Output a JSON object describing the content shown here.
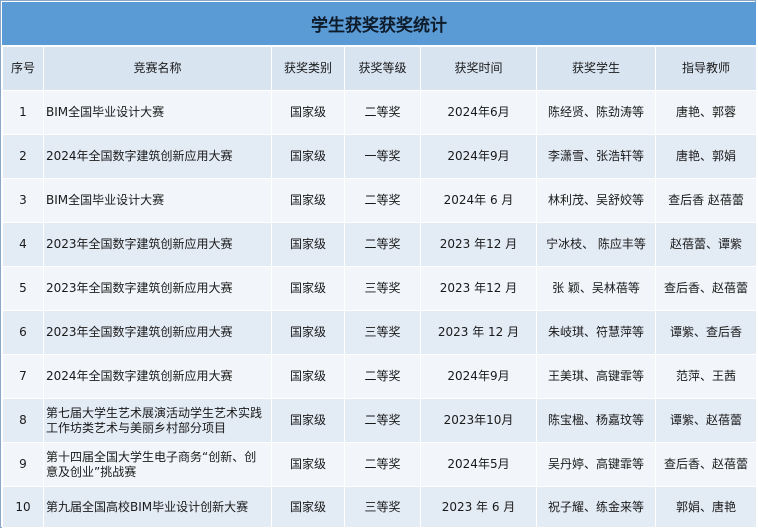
{
  "title": "学生获奖获奖统计",
  "columns": [
    "序号",
    "竞赛名称",
    "获奖类别",
    "获奖等级",
    "获奖时间",
    "获奖学生",
    "指导教师"
  ],
  "rows": [
    [
      "1",
      "BIM全国毕业设计大赛",
      "国家级",
      "二等奖",
      "2024年6月",
      "陈经贤、陈劲涛等",
      "唐艳、郭蓉"
    ],
    [
      "2",
      "2024年全国数字建筑创新应用大赛",
      "国家级",
      "一等奖",
      "2024年9月",
      "李潇雪、张浩轩等",
      "唐艳、郭娟"
    ],
    [
      "3",
      "BIM全国毕业设计大赛",
      "国家级",
      "二等奖",
      "2024年 6 月",
      "林利茂、吴舒姣等",
      "查后香 赵蓓蕾"
    ],
    [
      "4",
      "2023年全国数字建筑创新应用大赛",
      "国家级",
      "二等奖",
      "2023 年12 月",
      "宁冰枝、 陈应丰等",
      "赵蓓蕾、谭紫"
    ],
    [
      "5",
      "2023年全国数字建筑创新应用大赛",
      "国家级",
      "三等奖",
      "2023 年12 月",
      "张 颖、吴林蓓等",
      "查后香、赵蓓蕾"
    ],
    [
      "6",
      "2023年全国数字建筑创新应用大赛",
      "国家级",
      "三等奖",
      "2023 年 12 月",
      "朱岐琪、符慧萍等",
      "谭紫、查后香"
    ],
    [
      "7",
      "2024年全国数字建筑创新应用大赛",
      "国家级",
      "二等奖",
      "2024年9月",
      "王美琪、高键霏等",
      "范萍、王茜"
    ],
    [
      "8",
      "第七届大学生艺术展演活动学生艺术实践工作坊类艺术与美丽乡村部分项目",
      "国家级",
      "二等奖",
      "2023年10月",
      "陈宝楹、杨嘉玟等",
      "谭紫、赵蓓蕾"
    ],
    [
      "9",
      "第十四届全国大学生电子商务“创新、创意及创业”挑战赛",
      "国家级",
      "二等奖",
      "2024年5月",
      "吴丹婷、高键霏等",
      "查后香、赵蓓蕾"
    ],
    [
      "10",
      "第九届全国高校BIM毕业设计创新大赛",
      "国家级",
      "三等奖",
      "2023 年 6 月",
      "祝子耀、练金来等",
      "郭娟、唐艳"
    ]
  ]
}
